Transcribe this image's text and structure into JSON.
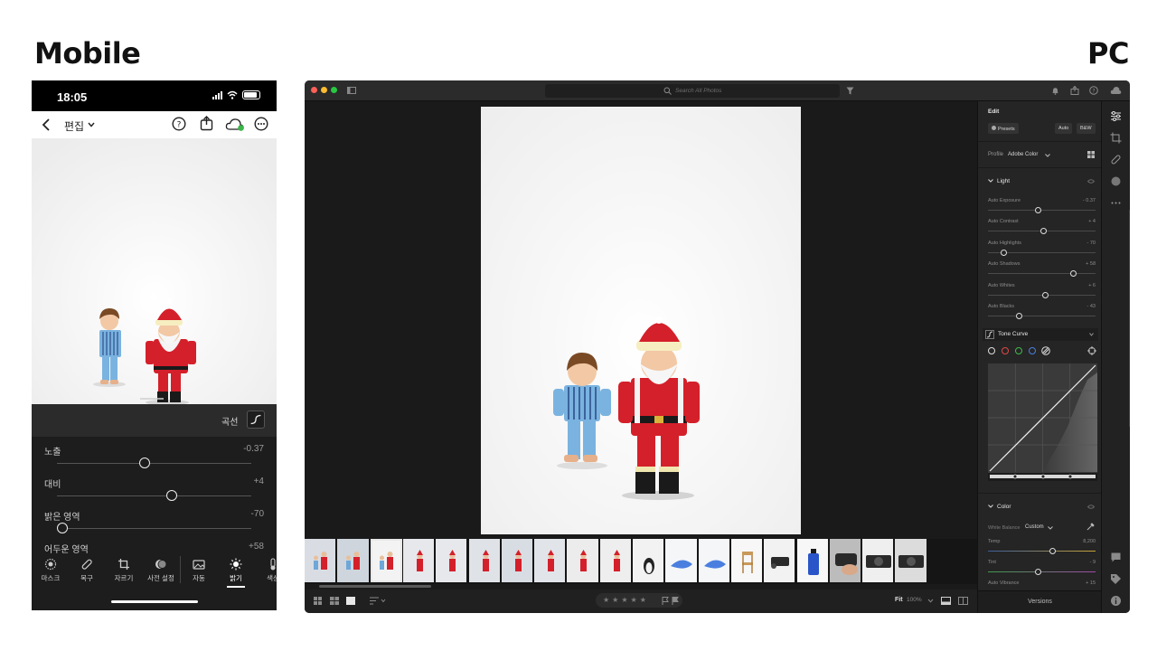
{
  "labels": {
    "mobile": "Mobile",
    "pc": "PC"
  },
  "mobile": {
    "status_time": "18:05",
    "title": "편집",
    "curve_label": "곡선",
    "sliders": [
      {
        "label": "노출",
        "value": "-0.37",
        "position": 0.45
      },
      {
        "label": "대비",
        "value": "+4",
        "position": 0.59
      },
      {
        "label": "밝은 영역",
        "value": "-70",
        "position": 0.03
      },
      {
        "label": "어두운 영역",
        "value": "+58",
        "position": 0.78
      }
    ],
    "tools": [
      "마스크",
      "복구",
      "자르기",
      "사전 설정",
      "자동",
      "밝기",
      "색상"
    ],
    "active_tool": "밝기"
  },
  "desktop": {
    "search_placeholder": "Search All Photos",
    "panel": {
      "title": "Edit",
      "presets_label": "Presets",
      "auto_label": "Auto",
      "bw_label": "B&W",
      "profile_label": "Profile",
      "profile_value": "Adobe Color",
      "light_label": "Light",
      "sliders": [
        {
          "label": "Auto Exposure",
          "value": "- 0.37",
          "position": 0.47
        },
        {
          "label": "Auto Contrast",
          "value": "+ 4",
          "position": 0.52
        },
        {
          "label": "Auto Highlights",
          "value": "- 70",
          "position": 0.15
        },
        {
          "label": "Auto Shadows",
          "value": "+ 58",
          "position": 0.79
        },
        {
          "label": "Auto Whites",
          "value": "+ 6",
          "position": 0.53
        },
        {
          "label": "Auto Blacks",
          "value": "- 43",
          "position": 0.29
        }
      ],
      "tone_curve_label": "Tone Curve",
      "color_label": "Color",
      "white_balance_label": "White Balance",
      "white_balance_value": "Custom",
      "color_sliders": [
        {
          "label": "Temp",
          "value": "8,200",
          "position": 0.6
        },
        {
          "label": "Tint",
          "value": "- 9",
          "position": 0.47
        },
        {
          "label": "Auto Vibrance",
          "value": "+ 15",
          "position": 0.55
        }
      ]
    },
    "bottombar": {
      "stars": "★★★★★",
      "fit_label": "Fit",
      "zoom_value": "100%",
      "versions_label": "Versions"
    },
    "filmstrip": [
      {
        "bg": "#d9dde3",
        "subject": "figure-pair"
      },
      {
        "bg": "#cfd5dc",
        "subject": "figure-pair"
      },
      {
        "bg": "#f3f3f3",
        "subject": "figure-pair"
      },
      {
        "bg": "#e6e8ec",
        "subject": "santa"
      },
      {
        "bg": "#e6e8ec",
        "subject": "santa"
      },
      {
        "bg": "#dfe3e8",
        "subject": "santa"
      },
      {
        "bg": "#d8dde3",
        "subject": "santa"
      },
      {
        "bg": "#e1e5ea",
        "subject": "santa"
      },
      {
        "bg": "#ececec",
        "subject": "santa"
      },
      {
        "bg": "#eeeeee",
        "subject": "santa"
      },
      {
        "bg": "#f2f2f2",
        "subject": "penguin"
      },
      {
        "bg": "#f4f6f8",
        "subject": "whale"
      },
      {
        "bg": "#f4f6f8",
        "subject": "whale"
      },
      {
        "bg": "#f7f7f7",
        "subject": "chair"
      },
      {
        "bg": "#f2f2f2",
        "subject": "gadget"
      },
      {
        "bg": "#f7f7f7",
        "subject": "bottle"
      },
      {
        "bg": "#bcbcbc",
        "subject": "hand"
      },
      {
        "bg": "#efefef",
        "subject": "camera"
      },
      {
        "bg": "#dcdcdc",
        "subject": "camera"
      }
    ],
    "selected_thumb": 2
  },
  "colors": {
    "panel_bg": "#252525",
    "accent_white": "#e8e8e8",
    "santa_red": "#d4202a",
    "child_blue": "#6ea7d8"
  }
}
